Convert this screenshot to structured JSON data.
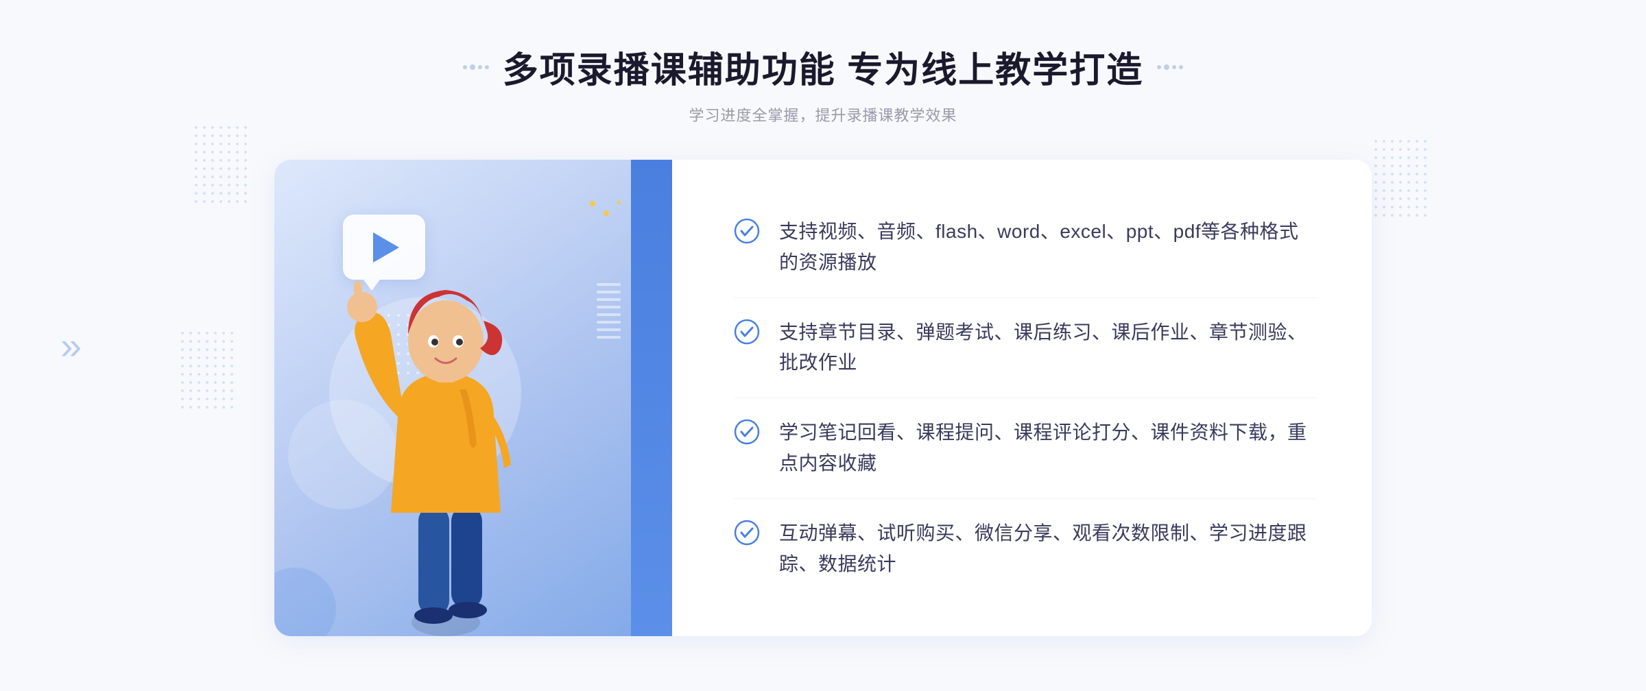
{
  "header": {
    "main_title": "多项录播课辅助功能 专为线上教学打造",
    "subtitle": "学习进度全掌握，提升录播课教学效果",
    "decorator_left": "decorators",
    "decorator_right": "decorators"
  },
  "features": [
    {
      "id": 1,
      "text": "支持视频、音频、flash、word、excel、ppt、pdf等各种格式的资源播放"
    },
    {
      "id": 2,
      "text": "支持章节目录、弹题考试、课后练习、课后作业、章节测验、批改作业"
    },
    {
      "id": 3,
      "text": "学习笔记回看、课程提问、课程评论打分、课件资料下载，重点内容收藏"
    },
    {
      "id": 4,
      "text": "互动弹幕、试听购买、微信分享、观看次数限制、学习进度跟踪、数据统计"
    }
  ],
  "chevrons": "»",
  "colors": {
    "primary_blue": "#4a7fe0",
    "light_blue": "#5b8fe8",
    "bg_gradient_start": "#dde8fb",
    "bg_gradient_end": "#7fa8e8",
    "text_dark": "#3a3a5c",
    "text_gray": "#999aaa"
  }
}
